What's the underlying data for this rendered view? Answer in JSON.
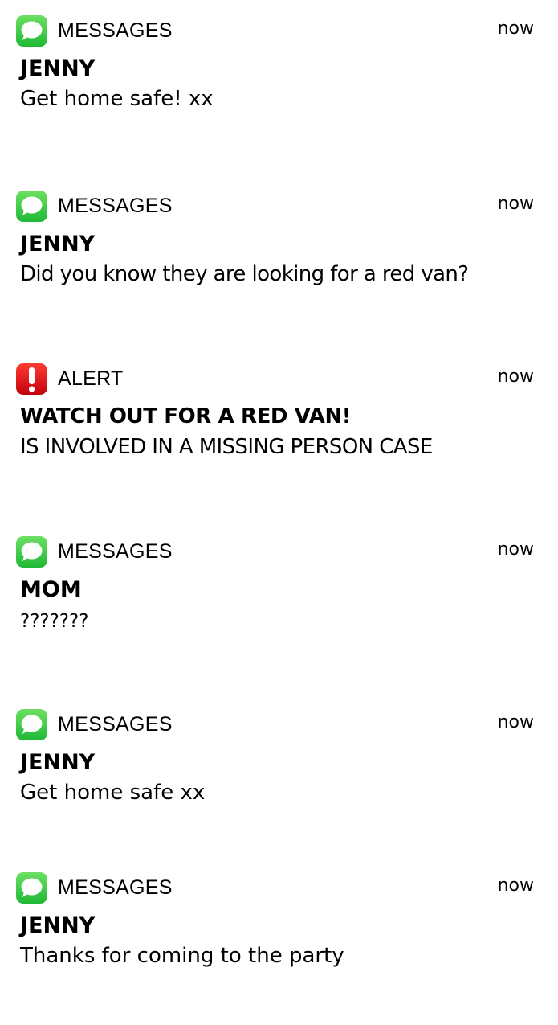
{
  "notifications": [
    {
      "app": "MESSAGES",
      "icon": "messages-icon",
      "time": "now",
      "sender": "JENNY",
      "message": "Get home safe! xx"
    },
    {
      "app": "MESSAGES",
      "icon": "messages-icon",
      "time": "now",
      "sender": "JENNY",
      "message": "Did you know they are looking for a red van?"
    },
    {
      "app": "ALERT",
      "icon": "alert-icon",
      "time": "now",
      "sender": "WATCH OUT FOR A RED VAN!",
      "message": "IS INVOLVED IN A MISSING PERSON CASE"
    },
    {
      "app": "MESSAGES",
      "icon": "messages-icon",
      "time": "now",
      "sender": "MOM",
      "message": "???????"
    },
    {
      "app": "MESSAGES",
      "icon": "messages-icon",
      "time": "now",
      "sender": "JENNY",
      "message": "Get home safe xx"
    },
    {
      "app": "MESSAGES",
      "icon": "messages-icon",
      "time": "now",
      "sender": "JENNY",
      "message": "Thanks for coming to the party"
    }
  ],
  "colors": {
    "messages_green_top": "#6ee062",
    "messages_green_bottom": "#1fb935",
    "alert_red_top": "#ff3b30",
    "alert_red_bottom": "#c4000e",
    "text": "#000000",
    "background": "#ffffff"
  }
}
